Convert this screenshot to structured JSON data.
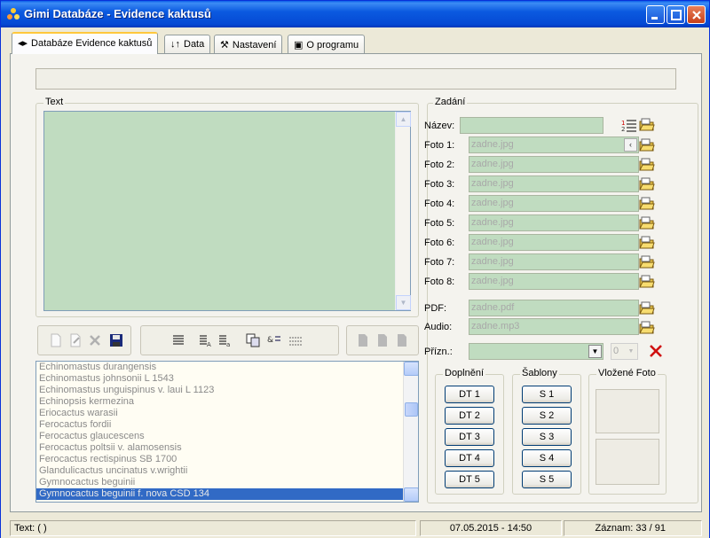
{
  "window": {
    "title": "Gimi Databáze - Evidence kaktusů"
  },
  "tabs": [
    {
      "label": "Databáze Evidence kaktusů",
      "icon": "◂▸"
    },
    {
      "label": "Data",
      "icon": "↓↑"
    },
    {
      "label": "Nastavení",
      "icon": "🔧"
    },
    {
      "label": "O programu",
      "icon": "◻"
    }
  ],
  "text_group": {
    "label": "Text"
  },
  "zadani": {
    "label": "Zadání",
    "nazev_label": "Název:",
    "nazev_value": "",
    "photos": [
      {
        "label": "Foto 1:",
        "value": "zadne.jpg"
      },
      {
        "label": "Foto 2:",
        "value": "zadne.jpg"
      },
      {
        "label": "Foto 3:",
        "value": "zadne.jpg"
      },
      {
        "label": "Foto 4:",
        "value": "zadne.jpg"
      },
      {
        "label": "Foto 5:",
        "value": "zadne.jpg"
      },
      {
        "label": "Foto 6:",
        "value": "zadne.jpg"
      },
      {
        "label": "Foto 7:",
        "value": "zadne.jpg"
      },
      {
        "label": "Foto 8:",
        "value": "zadne.jpg"
      }
    ],
    "pdf_label": "PDF:",
    "pdf_value": "zadne.pdf",
    "audio_label": "Audio:",
    "audio_value": "zadne.mp3",
    "prizn_label": "Přízn.:",
    "prizn_value": "",
    "prizn_num": "0"
  },
  "doplneni": {
    "label": "Doplnění",
    "buttons": [
      "DT 1",
      "DT 2",
      "DT 3",
      "DT 4",
      "DT 5"
    ]
  },
  "sablony": {
    "label": "Šablony",
    "buttons": [
      "S 1",
      "S 2",
      "S 3",
      "S 4",
      "S 5"
    ]
  },
  "vlozene": {
    "label": "Vložené Foto"
  },
  "list": {
    "items": [
      "Echinomastus durangensis",
      "Echinomastus johnsonii L 1543",
      "Echinomastus unguispinus v. laui L 1123",
      "Echinopsis kermezina",
      "Eriocactus warasii",
      "Ferocactus fordii",
      "Ferocactus glaucescens",
      "Ferocactus poltsii v. alamosensis",
      "Ferocactus rectispinus SB 1700",
      "Glandulicactus uncinatus v.wrightii",
      "Gymnocactus beguinii",
      "Gymnocactus beguinii f. nova CSD 134"
    ],
    "selected_index": 11
  },
  "status": {
    "text": "Text: (  )",
    "datetime": "07.05.2015 - 14:50",
    "record": "Záznam: 33 / 91"
  },
  "colors": {
    "field_bg": "#c0dcc0",
    "selection": "#316ac5",
    "titlebar": "#0549d4"
  }
}
